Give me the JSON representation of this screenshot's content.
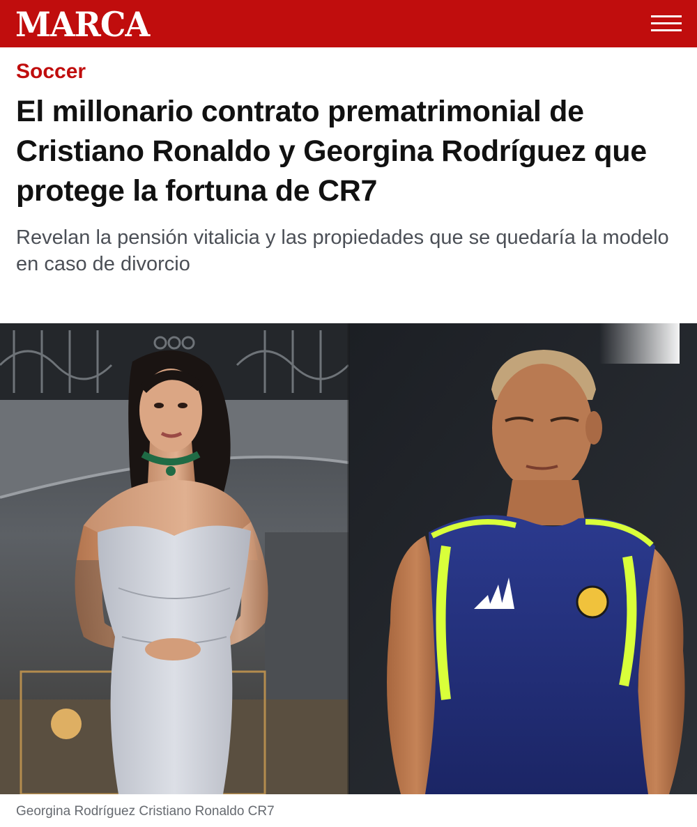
{
  "header": {
    "logo_text": "MARCA",
    "menu_icon": "hamburger-menu-icon",
    "brand_color": "#c00d0d"
  },
  "article": {
    "section": "Soccer",
    "headline": "El millonario contrato prematrimonial de Cristiano Ronaldo y Georgina Rodríguez que protege la fortuna de CR7",
    "subheadline": "Revelan la pensión vitalicia y las propiedades que se quedaría la modelo en caso de divorcio",
    "image_caption": "Georgina Rodríguez Cristiano Ronaldo CR7"
  }
}
